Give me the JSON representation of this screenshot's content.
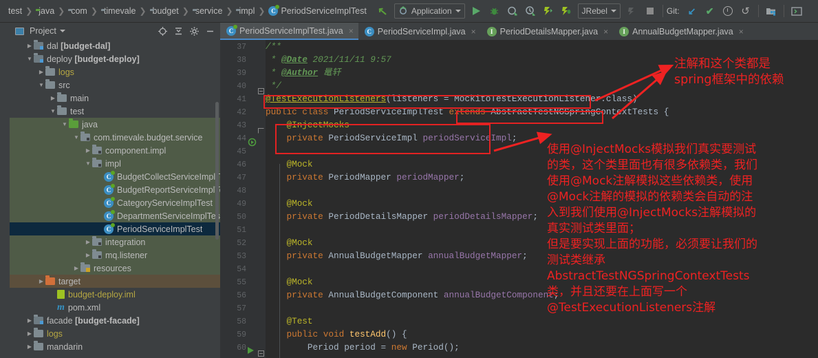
{
  "window": {
    "accent_blue": "#4a88c7",
    "annotation_red": "#ee2222",
    "editor_bg": "#2b2b2b",
    "chrome_bg": "#3c3f41"
  },
  "breadcrumb": {
    "items": [
      {
        "label": "test",
        "icon": "none"
      },
      {
        "label": "java",
        "icon": "folder-green-icon"
      },
      {
        "label": "com",
        "icon": "package-icon"
      },
      {
        "label": "timevale",
        "icon": "package-icon"
      },
      {
        "label": "budget",
        "icon": "package-icon"
      },
      {
        "label": "service",
        "icon": "package-icon"
      },
      {
        "label": "impl",
        "icon": "package-icon"
      },
      {
        "label": "PeriodServiceImplTest",
        "icon": "test-class-icon"
      }
    ]
  },
  "toolbar": {
    "back_icon": "back-arrow-icon",
    "run_config": {
      "label": "Application",
      "icon": "run-config-icon",
      "caret": "chevron-down-icon"
    },
    "buttons": [
      {
        "name": "run-button",
        "icon": "play-icon"
      },
      {
        "name": "debug-button",
        "icon": "bug-icon"
      },
      {
        "name": "run-with-coverage-button",
        "icon": "coverage-icon"
      },
      {
        "name": "profile-button",
        "icon": "profiler-icon"
      },
      {
        "name": "jrebel-run-button",
        "icon": "jrebel-run-icon"
      },
      {
        "name": "jrebel-debug-button",
        "icon": "jrebel-debug-icon"
      }
    ],
    "jrebel": {
      "label": "JRebel",
      "caret": "chevron-down-icon"
    },
    "attach_icon": "attach-profiler-icon",
    "stop_icon": "stop-icon",
    "git": {
      "label": "Git:",
      "update_icon": "update-project-icon",
      "commit_icon": "commit-icon",
      "history_icon": "history-icon",
      "rollback_icon": "rollback-icon"
    },
    "right_buttons": [
      {
        "name": "project-structure-button",
        "icon": "project-structure-icon"
      },
      {
        "name": "search-everywhere-button",
        "icon": "terminal-icon"
      }
    ]
  },
  "project_panel": {
    "title": "Project",
    "title_caret": "chevron-down-icon",
    "header_icons": [
      {
        "name": "select-opened-file-button",
        "icon": "target-icon"
      },
      {
        "name": "collapse-all-button",
        "icon": "collapse-all-icon"
      },
      {
        "name": "settings-button",
        "icon": "gear-icon"
      },
      {
        "name": "hide-panel-button",
        "icon": "minimize-icon"
      }
    ],
    "tree": [
      {
        "indent": 1,
        "twisty": "collapsed",
        "icon": "module-icon",
        "label": "dal ",
        "bold": "[budget-dal]",
        "style": "normal"
      },
      {
        "indent": 1,
        "twisty": "expanded",
        "icon": "module-icon",
        "label": "deploy ",
        "bold": "[budget-deploy]",
        "style": "normal"
      },
      {
        "indent": 2,
        "twisty": "collapsed",
        "icon": "folder-icon",
        "label": "logs",
        "bold": "",
        "style": "yellow"
      },
      {
        "indent": 2,
        "twisty": "expanded",
        "icon": "folder-icon",
        "label": "src",
        "bold": "",
        "style": "normal"
      },
      {
        "indent": 3,
        "twisty": "collapsed",
        "icon": "folder-icon",
        "label": "main",
        "bold": "",
        "style": "normal"
      },
      {
        "indent": 3,
        "twisty": "expanded",
        "icon": "folder-icon",
        "label": "test",
        "bold": "",
        "style": "normal"
      },
      {
        "indent": 4,
        "twisty": "expanded",
        "icon": "folder-green-icon",
        "label": "java",
        "bold": "",
        "style": "test-root"
      },
      {
        "indent": 5,
        "twisty": "expanded",
        "icon": "package-icon",
        "label": "com.timevale.budget.service",
        "bold": "",
        "style": "test-root"
      },
      {
        "indent": 6,
        "twisty": "collapsed",
        "icon": "package-icon",
        "label": "component.impl",
        "bold": "",
        "style": "test-root"
      },
      {
        "indent": 6,
        "twisty": "expanded",
        "icon": "package-icon",
        "label": "impl",
        "bold": "",
        "style": "test-root"
      },
      {
        "indent": 7,
        "twisty": "none",
        "icon": "test-class-icon",
        "label": "BudgetCollectServiceImplTe",
        "bold": "",
        "style": "test-root"
      },
      {
        "indent": 7,
        "twisty": "none",
        "icon": "test-class-icon",
        "label": "BudgetReportServiceImplTe",
        "bold": "",
        "style": "test-root"
      },
      {
        "indent": 7,
        "twisty": "none",
        "icon": "test-class-icon",
        "label": "CategoryServiceImplTest",
        "bold": "",
        "style": "test-root"
      },
      {
        "indent": 7,
        "twisty": "none",
        "icon": "test-class-icon",
        "label": "DepartmentServiceImplTest",
        "bold": "",
        "style": "test-root"
      },
      {
        "indent": 7,
        "twisty": "none",
        "icon": "test-class-icon",
        "label": "PeriodServiceImplTest",
        "bold": "",
        "style": "selected"
      },
      {
        "indent": 6,
        "twisty": "collapsed",
        "icon": "package-icon",
        "label": "integration",
        "bold": "",
        "style": "test-root"
      },
      {
        "indent": 6,
        "twisty": "collapsed",
        "icon": "package-icon",
        "label": "mq.listener",
        "bold": "",
        "style": "test-root"
      },
      {
        "indent": 5,
        "twisty": "collapsed",
        "icon": "resource-folder-icon",
        "label": "resources",
        "bold": "",
        "style": "test-root"
      },
      {
        "indent": 2,
        "twisty": "collapsed",
        "icon": "folder-orange-icon",
        "label": "target",
        "bold": "",
        "style": "excluded"
      },
      {
        "indent": 3,
        "twisty": "none",
        "icon": "iml-file-icon",
        "label": "budget-deploy.iml",
        "bold": "",
        "style": "yellow"
      },
      {
        "indent": 3,
        "twisty": "none",
        "icon": "maven-file-icon",
        "label": "pom.xml",
        "bold": "",
        "style": "normal"
      },
      {
        "indent": 1,
        "twisty": "collapsed",
        "icon": "module-icon",
        "label": "facade ",
        "bold": "[budget-facade]",
        "style": "normal"
      },
      {
        "indent": 1,
        "twisty": "collapsed",
        "icon": "folder-icon",
        "label": "logs",
        "bold": "",
        "style": "yellow"
      },
      {
        "indent": 1,
        "twisty": "collapsed",
        "icon": "folder-icon",
        "label": "mandarin",
        "bold": "",
        "style": "normal"
      }
    ]
  },
  "editor": {
    "tabs": [
      {
        "label": "PeriodServiceImplTest.java",
        "icon": "test-class-icon",
        "active": true,
        "close": "×"
      },
      {
        "label": "PeriodServiceImpl.java",
        "icon": "class-icon",
        "active": false,
        "close": "×"
      },
      {
        "label": "PeriodDetailsMapper.java",
        "icon": "interface-icon",
        "active": false,
        "close": "×"
      },
      {
        "label": "AnnualBudgetMapper.java",
        "icon": "interface-icon",
        "active": false,
        "close": "×"
      }
    ],
    "first_line_number": 37,
    "lines": [
      {
        "n": 37,
        "text": "/**"
      },
      {
        "n": 38,
        "text": " * @Date 2021/11/11 9:57"
      },
      {
        "n": 39,
        "text": " * @Author 鼌轩"
      },
      {
        "n": 40,
        "text": " */"
      },
      {
        "n": 41,
        "text": "@TestExecutionListeners(listeners = MockitoTestExecutionListener.class)"
      },
      {
        "n": 42,
        "text": "public class PeriodServiceImplTest extends AbstractTestNGSpringContextTests {"
      },
      {
        "n": 43,
        "text": "    @InjectMocks"
      },
      {
        "n": 44,
        "text": "    private PeriodServiceImpl periodServiceImpl;"
      },
      {
        "n": 45,
        "text": ""
      },
      {
        "n": 46,
        "text": "    @Mock"
      },
      {
        "n": 47,
        "text": "    private PeriodMapper periodMapper;"
      },
      {
        "n": 48,
        "text": ""
      },
      {
        "n": 49,
        "text": "    @Mock"
      },
      {
        "n": 50,
        "text": "    private PeriodDetailsMapper periodDetailsMapper;"
      },
      {
        "n": 51,
        "text": ""
      },
      {
        "n": 52,
        "text": "    @Mock"
      },
      {
        "n": 53,
        "text": "    private AnnualBudgetMapper annualBudgetMapper;"
      },
      {
        "n": 54,
        "text": ""
      },
      {
        "n": 55,
        "text": "    @Mock"
      },
      {
        "n": 56,
        "text": "    private AnnualBudgetComponent annualBudgetComponent;"
      },
      {
        "n": 57,
        "text": ""
      },
      {
        "n": 58,
        "text": "    @Test"
      },
      {
        "n": 59,
        "text": "    public void testAdd() {"
      },
      {
        "n": 60,
        "text": "        Period period = new Period();"
      }
    ]
  },
  "annotations": {
    "note_1": "注解和这个类都是\nspring框架中的依赖",
    "note_2_lines": [
      "使用@InjectMocks模拟我们真实要测试",
      "的类，这个类里面也有很多依赖类，我们",
      "使用@Mock注解模拟这些依赖类，使用",
      "@Mock注解的模拟的依赖类会自动的注",
      "入到我们使用@InjectMocks注解模拟的",
      "真实测试类里面；",
      "但是要实现上面的功能，必须要让我们的",
      "测试类继承",
      "AbstractTestNGSpringContextTests",
      "类，并且还要在上面写一个",
      "@TestExecutionListeners注解"
    ],
    "highlight_boxes": [
      {
        "name": "testexecutionlisteners-highlight"
      },
      {
        "name": "abstracttestng-highlight"
      },
      {
        "name": "injectmocks-highlight"
      }
    ]
  }
}
